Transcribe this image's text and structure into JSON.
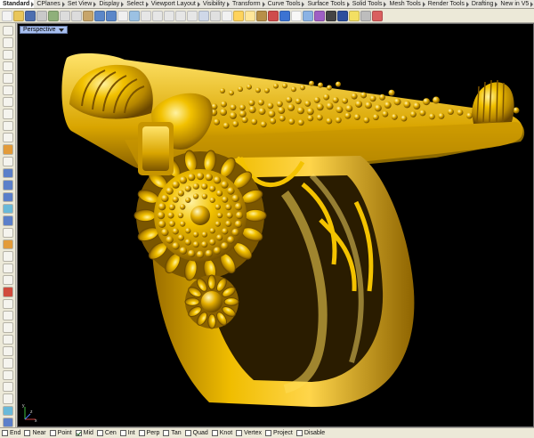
{
  "tabs": [
    {
      "label": "Standard",
      "active": true
    },
    {
      "label": "CPlanes"
    },
    {
      "label": "Set View"
    },
    {
      "label": "Display"
    },
    {
      "label": "Select"
    },
    {
      "label": "Viewport Layout"
    },
    {
      "label": "Visibility"
    },
    {
      "label": "Transform"
    },
    {
      "label": "Curve Tools"
    },
    {
      "label": "Surface Tools"
    },
    {
      "label": "Solid Tools"
    },
    {
      "label": "Mesh Tools"
    },
    {
      "label": "Render Tools"
    },
    {
      "label": "Drafting"
    },
    {
      "label": "New in V5"
    }
  ],
  "toolbar": {
    "buttons": [
      {
        "name": "new-file-icon",
        "color": "#f3f3f3"
      },
      {
        "name": "open-icon",
        "color": "#e9c65a"
      },
      {
        "name": "save-icon",
        "color": "#4d6fb0"
      },
      {
        "name": "print-icon",
        "color": "#c9c9c9"
      },
      {
        "name": "import-icon",
        "color": "#8fb07a"
      },
      {
        "name": "cut-icon",
        "color": "#dcdcdc"
      },
      {
        "name": "copy-icon",
        "color": "#dcdcdc"
      },
      {
        "name": "paste-icon",
        "color": "#c7a56a"
      },
      {
        "name": "undo-icon",
        "color": "#5b87c9"
      },
      {
        "name": "redo-icon",
        "color": "#5b87c9"
      },
      {
        "name": "pan-icon",
        "color": "#f0f0f0"
      },
      {
        "name": "rotate-view-icon",
        "color": "#9bc1e3"
      },
      {
        "name": "zoom-icon",
        "color": "#e6e6e6"
      },
      {
        "name": "zoom-window-icon",
        "color": "#e6e6e6"
      },
      {
        "name": "zoom-extents-icon",
        "color": "#e6e6e6"
      },
      {
        "name": "zoom-selected-icon",
        "color": "#e6e6e6"
      },
      {
        "name": "undo-view-icon",
        "color": "#e6e6e6"
      },
      {
        "name": "four-views-icon",
        "color": "#cfd8e8"
      },
      {
        "name": "grid-icon",
        "color": "#e0e0e0"
      },
      {
        "name": "select-icon",
        "color": "#f1f1f1"
      },
      {
        "name": "hide-icon",
        "color": "#ffd35c"
      },
      {
        "name": "show-icon",
        "color": "#ffe69a"
      },
      {
        "name": "lock-icon",
        "color": "#b88f48"
      },
      {
        "name": "layers-icon",
        "color": "#cf4c4c"
      },
      {
        "name": "properties-icon",
        "color": "#3c73d2"
      },
      {
        "name": "wireframe-icon",
        "color": "#f7f7f7"
      },
      {
        "name": "shaded-icon",
        "color": "#8ab2e4"
      },
      {
        "name": "rendered-icon",
        "color": "#9f5fc4"
      },
      {
        "name": "material-icon",
        "color": "#444444"
      },
      {
        "name": "render-icon",
        "color": "#2d4f9e"
      },
      {
        "name": "light-icon",
        "color": "#f3df62"
      },
      {
        "name": "options-icon",
        "color": "#bdbdbd"
      },
      {
        "name": "help-icon",
        "color": "#d95f5f"
      }
    ]
  },
  "left_tools": [
    {
      "name": "select-arrow-icon",
      "style": ""
    },
    {
      "name": "point-icon",
      "style": ""
    },
    {
      "name": "polyline-icon",
      "style": ""
    },
    {
      "name": "curve-icon",
      "style": ""
    },
    {
      "name": "circle-icon",
      "style": ""
    },
    {
      "name": "arc-icon",
      "style": ""
    },
    {
      "name": "ellipse-icon",
      "style": ""
    },
    {
      "name": "rectangle-icon",
      "style": ""
    },
    {
      "name": "polygon-icon",
      "style": ""
    },
    {
      "name": "free-form-icon",
      "style": ""
    },
    {
      "name": "fillet-curves-icon",
      "style": "orange"
    },
    {
      "name": "offset-curve-icon",
      "style": ""
    },
    {
      "name": "surface-from-curves-icon",
      "style": "blue"
    },
    {
      "name": "extrude-icon",
      "style": "blue"
    },
    {
      "name": "box-icon",
      "style": "blue"
    },
    {
      "name": "sphere-icon",
      "style": "cyan"
    },
    {
      "name": "cylinder-icon",
      "style": "blue"
    },
    {
      "name": "mesh-icon",
      "style": ""
    },
    {
      "name": "boolean-icon",
      "style": "orange"
    },
    {
      "name": "trim-icon",
      "style": ""
    },
    {
      "name": "split-icon",
      "style": ""
    },
    {
      "name": "join-icon",
      "style": ""
    },
    {
      "name": "explode-icon",
      "style": "red"
    },
    {
      "name": "group-icon",
      "style": ""
    },
    {
      "name": "move-icon",
      "style": ""
    },
    {
      "name": "copy-icon",
      "style": ""
    },
    {
      "name": "rotate-icon",
      "style": ""
    },
    {
      "name": "scale-icon",
      "style": ""
    },
    {
      "name": "mirror-icon",
      "style": ""
    },
    {
      "name": "array-icon",
      "style": ""
    },
    {
      "name": "dimension-icon",
      "style": ""
    },
    {
      "name": "text-icon",
      "style": ""
    },
    {
      "name": "analyze-icon",
      "style": "cyan"
    },
    {
      "name": "render-sphere-icon",
      "style": "blue"
    }
  ],
  "viewport": {
    "title": "Perspective",
    "background": "#000000",
    "object_color": "#e5b500"
  },
  "osnaps": [
    {
      "label": "End",
      "checked": false
    },
    {
      "label": "Near",
      "checked": false
    },
    {
      "label": "Point",
      "checked": false
    },
    {
      "label": "Mid",
      "checked": true
    },
    {
      "label": "Cen",
      "checked": false
    },
    {
      "label": "Int",
      "checked": false
    },
    {
      "label": "Perp",
      "checked": false
    },
    {
      "label": "Tan",
      "checked": false
    },
    {
      "label": "Quad",
      "checked": false
    },
    {
      "label": "Knot",
      "checked": false
    },
    {
      "label": "Vertex",
      "checked": false
    },
    {
      "label": "Project",
      "checked": false
    },
    {
      "label": "Disable",
      "checked": false
    }
  ],
  "axes": {
    "x": "x",
    "y": "y",
    "z": "z"
  }
}
